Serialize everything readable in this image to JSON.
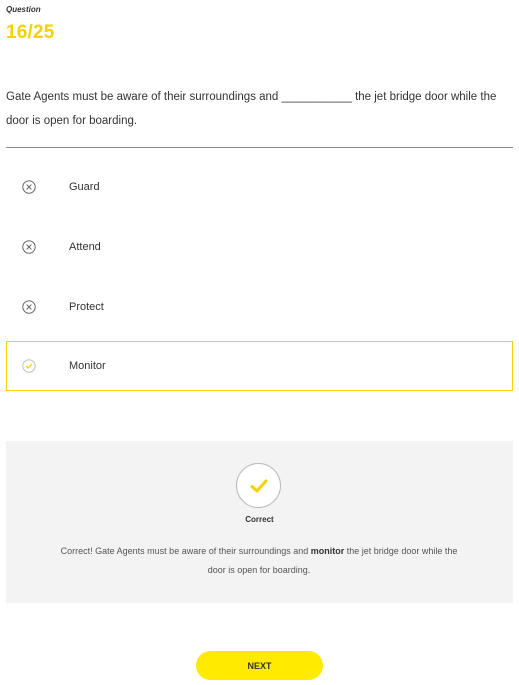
{
  "header": {
    "label": "Question",
    "counter": "16/25"
  },
  "question": {
    "text": "Gate Agents must be aware of their surroundings and ___________ the jet bridge door while the door is open for boarding."
  },
  "options": [
    {
      "label": "Guard",
      "icon": "x-circle-icon",
      "state": "incorrect"
    },
    {
      "label": "Attend",
      "icon": "x-circle-icon",
      "state": "incorrect"
    },
    {
      "label": "Protect",
      "icon": "x-circle-icon",
      "state": "incorrect"
    },
    {
      "label": "Monitor",
      "icon": "check-circle-icon",
      "state": "selected-correct"
    }
  ],
  "feedback": {
    "icon": "check-icon",
    "status": "Correct",
    "text_before": "Correct! Gate Agents must be aware of their surroundings and ",
    "text_bold": "monitor",
    "text_after": " the jet bridge door while the door is open for boarding."
  },
  "footer": {
    "next_label": "NEXT"
  },
  "colors": {
    "accent": "#f5d200",
    "button": "#ffea00",
    "feedback_bg": "#f3f3f3",
    "divider": "#8a8a8a"
  }
}
